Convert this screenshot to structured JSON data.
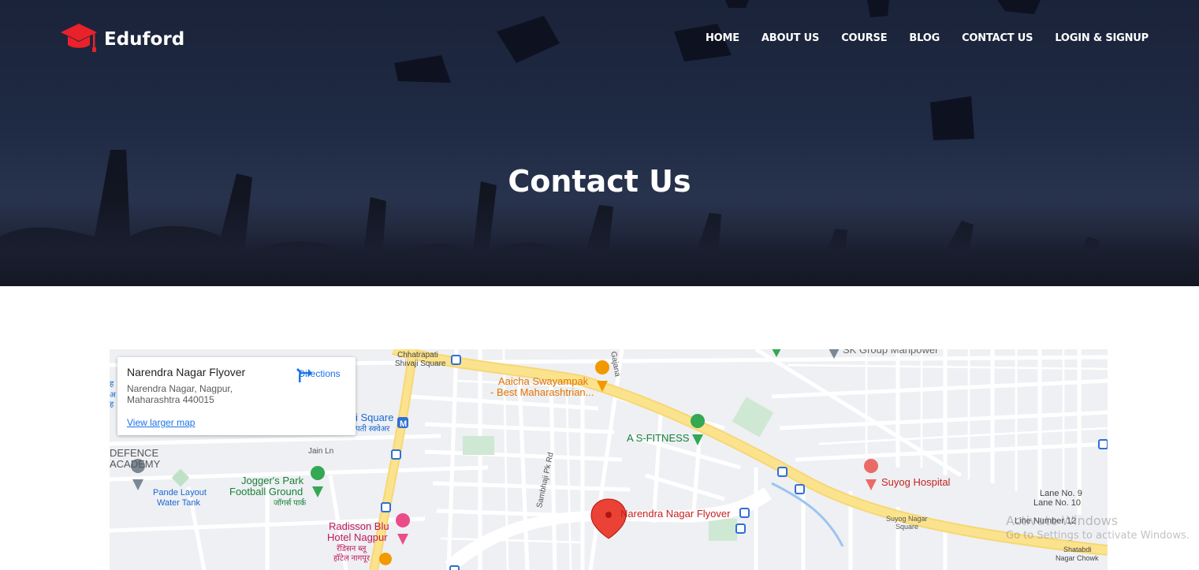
{
  "brand": {
    "name": "Eduford",
    "logo_icon": "graduation-cap-icon",
    "accent": "#e8212a"
  },
  "nav": [
    {
      "label": "HOME"
    },
    {
      "label": "ABOUT US"
    },
    {
      "label": "COURSE"
    },
    {
      "label": "BLOG"
    },
    {
      "label": "CONTACT US"
    },
    {
      "label": "LOGIN & SIGNUP"
    }
  ],
  "hero": {
    "title": "Contact Us"
  },
  "map": {
    "place_name": "Narendra Nagar Flyover",
    "address_line1": "Narendra Nagar, Nagpur,",
    "address_line2": "Maharashtra 440015",
    "directions_label": "Directions",
    "larger_map_label": "View larger map",
    "labels": {
      "chhatrapati": "Chhatrapati",
      "shivaji_square": "Shivaji Square",
      "aaicha1": "Aaicha Swayampak",
      "aaicha2": "- Best Maharashtrian...",
      "gajanan": "Gajana",
      "sk_group": "SK Group Manpower",
      "square_frag": "i Square",
      "square_hindi": "पती स्क्वेअर",
      "jain_ln": "Jain Ln",
      "defence1": "DEFENCE",
      "defence2": "ACADEMY",
      "pande1": "Pande Layout",
      "pande2": "Water Tank",
      "joggers1": "Jogger's Park",
      "joggers2": "Football Ground",
      "joggers3": "जॉगर्स पार्क",
      "asfitness": "A S-FITNESS",
      "sambhaji": "Sambhaji Pk Rd",
      "flyover_pin": "Narendra Nagar Flyover",
      "suyog_hospital": "Suyog Hospital",
      "suyog_sq1": "Suyog Nagar",
      "suyog_sq2": "Square",
      "radisson1": "Radisson Blu",
      "radisson2": "Hotel Nagpur",
      "radisson3": "रॅडिसन ब्लू",
      "radisson4": "हॉटेल नागपूर",
      "lane9": "Lane No. 9",
      "lane10": "Lane No. 10",
      "lane12": "Line Number 12",
      "shatabdi1": "Shatabdi",
      "shatabdi2": "Nagar Chowk",
      "left_frag1": "ह",
      "left_frag2": "अ",
      "left_frag3": "ह"
    }
  },
  "os_watermark": {
    "line1": "Activate Windows",
    "line2": "Go to Settings to activate Windows."
  }
}
